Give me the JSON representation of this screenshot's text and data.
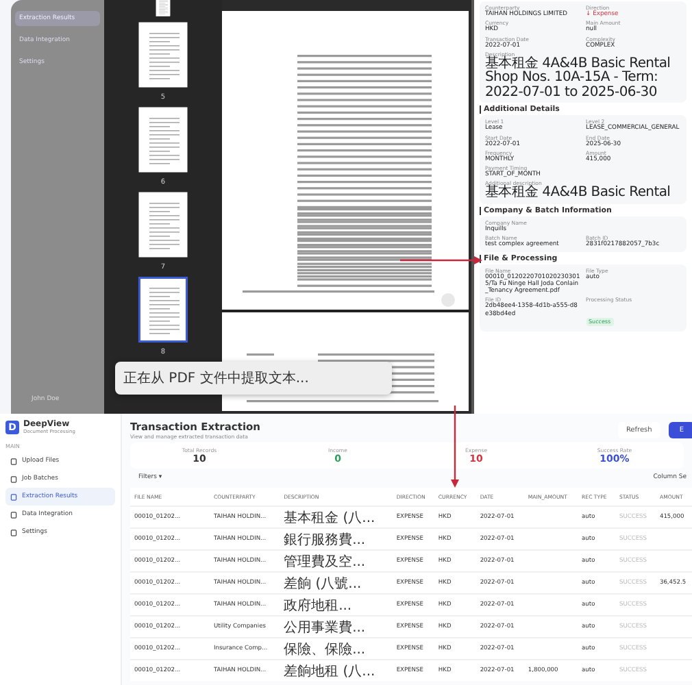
{
  "viewer": {
    "sidebar": {
      "items": [
        {
          "label": "Extraction Results",
          "selected": true
        },
        {
          "label": "Data Integration",
          "selected": false
        },
        {
          "label": "Settings",
          "selected": false
        }
      ],
      "user": "John Doe"
    },
    "thumbnails": [
      {
        "selected": false
      },
      {
        "page": "5",
        "selected": false
      },
      {
        "page": "6",
        "selected": false
      },
      {
        "page": "7",
        "selected": false
      },
      {
        "page": "8",
        "selected": true
      }
    ],
    "toast": "正在从 PDF 文件中提取文本...",
    "details": {
      "sections": [
        {
          "fields": [
            {
              "label": "Counterparty",
              "value": "TAIHAN HOLDINGS LIMITED",
              "kind": "text"
            },
            {
              "label": "Direction",
              "value": "↓ Expense",
              "kind": "expense"
            },
            {
              "label": "Currency",
              "value": "HKD",
              "kind": "text"
            },
            {
              "label": "Main Amount",
              "value": "null",
              "kind": "text"
            },
            {
              "label": "Transaction Date",
              "value": "2022-07-01",
              "kind": "text"
            },
            {
              "label": "Complexity",
              "value": "COMPLEX",
              "kind": "text"
            },
            {
              "label": "Description",
              "value": "基本租金 4A&4B Basic Rental Shop Nos. 10A-15A - Term: 2022-07-01 to 2025-06-30",
              "kind": "wide"
            }
          ]
        },
        {
          "title": "Additional Details",
          "fields": [
            {
              "label": "Level 1",
              "value": "Lease",
              "kind": "text"
            },
            {
              "label": "Level 2",
              "value": "LEASE_COMMERCIAL_GENERAL",
              "kind": "text"
            },
            {
              "label": "Start Date",
              "value": "2022-07-01",
              "kind": "text"
            },
            {
              "label": "End Date",
              "value": "2025-06-30",
              "kind": "text"
            },
            {
              "label": "Frequency",
              "value": "MONTHLY",
              "kind": "text"
            },
            {
              "label": "Amount",
              "value": "415,000",
              "kind": "text"
            },
            {
              "label": "Payment Timing",
              "value": "START_OF_MONTH",
              "kind": "wide"
            },
            {
              "label": "Additional description",
              "value": "基本租金 4A&4B Basic Rental",
              "kind": "wide"
            }
          ]
        },
        {
          "title": "Company & Batch Information",
          "fields": [
            {
              "label": "Company Name",
              "value": "Inquills",
              "kind": "wide"
            },
            {
              "label": "Batch Name",
              "value": "test complex agreement",
              "kind": "text"
            },
            {
              "label": "Batch ID",
              "value": "2831f0217882057_7b3c",
              "kind": "text"
            }
          ]
        },
        {
          "title": "File & Processing",
          "fields": [
            {
              "label": "File Name",
              "value": "00010_01202207010202303015/Ta Fu Ninge Hall Joda Conlain_Tenancy Agreement.pdf",
              "kind": "text"
            },
            {
              "label": "File Type",
              "value": "auto",
              "kind": "text"
            },
            {
              "label": "File ID",
              "value": "2db48ee4-1358-4d1b-a555-d8e38bd4ed",
              "kind": "text"
            },
            {
              "label": "Processing Status",
              "value": "Success",
              "kind": "status"
            }
          ]
        }
      ]
    }
  },
  "app": {
    "logo": "D",
    "brand": "DeepView",
    "tagline": "Document Processing",
    "nav_heading": "MAIN",
    "nav": [
      {
        "label": "Upload Files",
        "selected": false
      },
      {
        "label": "Job Batches",
        "selected": false
      },
      {
        "label": "Extraction Results",
        "selected": true
      },
      {
        "label": "Data Integration",
        "selected": false
      },
      {
        "label": "Settings",
        "selected": false
      }
    ],
    "title": "Transaction Extraction",
    "subtitle": "View and manage extracted transaction data",
    "buttons": [
      {
        "label": "Refresh",
        "kind": "outline"
      },
      {
        "label": "E",
        "kind": "primary"
      }
    ],
    "stats": [
      {
        "label": "Total Records",
        "value": "10",
        "color": "#333333"
      },
      {
        "label": "Income",
        "value": "0",
        "color": "#2e9d5a"
      },
      {
        "label": "Expense",
        "value": "10",
        "color": "#d2333f"
      },
      {
        "label": "Success Rate",
        "value": "100%",
        "color": "#3b4ed8"
      }
    ],
    "filters": "Filters ▾",
    "column_settings": "Column Se",
    "table": {
      "columns": [
        "FILE NAME",
        "COUNTERPARTY",
        "DESCRIPTION",
        "DIRECTION",
        "CURRENCY",
        "DATE",
        "MAIN_AMOUNT",
        "REC TYPE",
        "STATUS",
        "AMOUNT"
      ],
      "rows": [
        [
          "00010_01202...",
          "TAIHAN HOLDIN...",
          "基本租金 (八...",
          "EXPENSE",
          "HKD",
          "2022-07-01",
          "",
          "auto",
          "SUCCESS",
          "415,000"
        ],
        [
          "00010_01202...",
          "TAIHAN HOLDIN...",
          "銀行服務費...",
          "EXPENSE",
          "HKD",
          "2022-07-01",
          "",
          "auto",
          "SUCCESS",
          ""
        ],
        [
          "00010_01202...",
          "TAIHAN HOLDIN...",
          "管理費及空...",
          "EXPENSE",
          "HKD",
          "2022-07-01",
          "",
          "auto",
          "SUCCESS",
          ""
        ],
        [
          "00010_01202...",
          "TAIHAN HOLDIN...",
          "差餉 (八號...",
          "EXPENSE",
          "HKD",
          "2022-07-01",
          "",
          "auto",
          "SUCCESS",
          "36,452.5"
        ],
        [
          "00010_01202...",
          "TAIHAN HOLDIN...",
          "政府地租...",
          "EXPENSE",
          "HKD",
          "2022-07-01",
          "",
          "auto",
          "SUCCESS",
          ""
        ],
        [
          "00010_01202...",
          "Utility Companies",
          "公用事業費...",
          "EXPENSE",
          "HKD",
          "2022-07-01",
          "",
          "auto",
          "SUCCESS",
          ""
        ],
        [
          "00010_01202...",
          "Insurance Comp...",
          "保險、保險...",
          "EXPENSE",
          "HKD",
          "2022-07-01",
          "",
          "auto",
          "SUCCESS",
          ""
        ],
        [
          "00010_01202...",
          "TAIHAN HOLDIN...",
          "差餉地租 (八...",
          "EXPENSE",
          "HKD",
          "2022-07-01",
          "1,800,000",
          "auto",
          "SUCCESS",
          ""
        ]
      ]
    }
  }
}
